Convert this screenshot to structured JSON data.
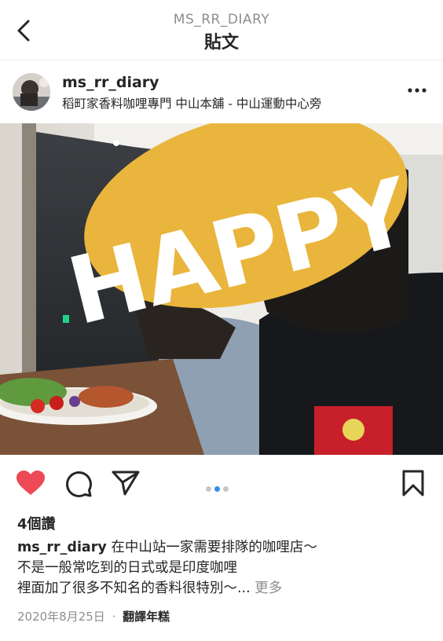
{
  "header": {
    "subtitle": "MS_RR_DIARY",
    "title": "貼文"
  },
  "post": {
    "username": "ms_rr_diary",
    "location": "稻町家香料咖哩專門 中山本舖 - 中山運動中心旁",
    "sticker_text": "HAPPY",
    "carousel": {
      "count": 3,
      "active_index": 1
    },
    "liked": true,
    "likes": "4個讚",
    "caption": {
      "user": "ms_rr_diary",
      "line1": "在中山站一家需要排隊的咖哩店～",
      "line2": "不是一般常吃到的日式或是印度咖哩",
      "line3": "裡面加了很多不知名的香料很特別～...",
      "more_label": "更多"
    },
    "date": "2020年8月25日",
    "separator": "·",
    "translate_label": "翻譯年糕"
  },
  "icons": {
    "back": "chevron-left-icon",
    "more": "more-horizontal-icon",
    "like": "heart-icon",
    "comment": "comment-icon",
    "share": "paper-plane-icon",
    "save": "bookmark-icon"
  },
  "colors": {
    "like_red": "#ed4956",
    "dot_active": "#2e92ea",
    "sticker_yellow": "#eab53d",
    "muted_text": "#8e8e8e"
  }
}
